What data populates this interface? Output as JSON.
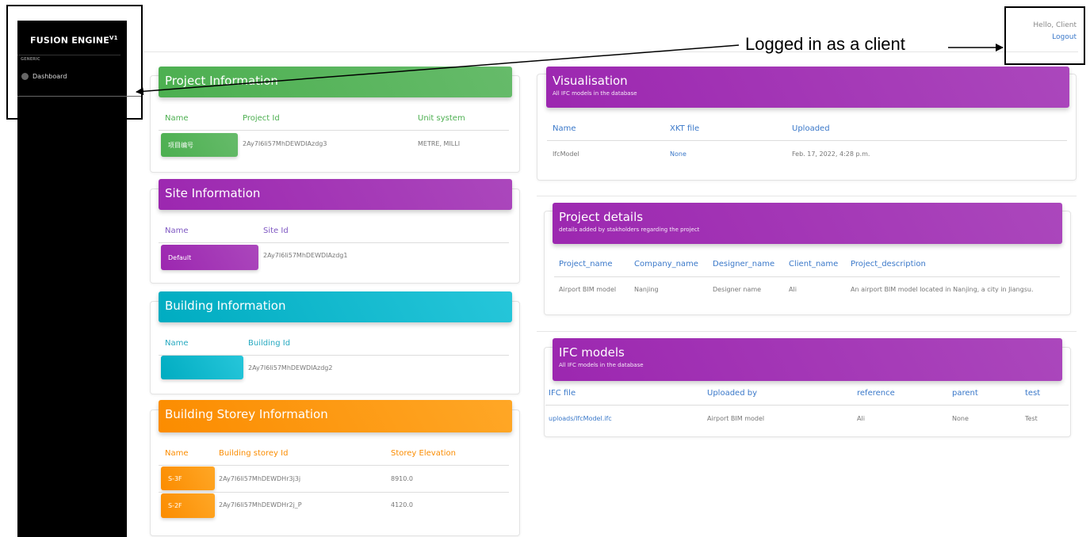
{
  "sidebar": {
    "brand": "FUSION ENGINE",
    "brand_sup": "V1",
    "section": "GENERIC",
    "items": [
      {
        "label": "Dashboard",
        "icon": "dashboard-icon"
      }
    ]
  },
  "header": {
    "greeting": "Hello, Client",
    "logout": "Logout"
  },
  "annotation": "Logged in as a client",
  "project_info": {
    "title": "Project Information",
    "columns": [
      "Name",
      "Project Id",
      "Unit system"
    ],
    "row": {
      "name": "项目编号",
      "id": "2Ay7I6li57MhDEWDIAzdg3",
      "unit": "METRE, MILLI"
    }
  },
  "site_info": {
    "title": "Site Information",
    "columns": [
      "Name",
      "Site Id"
    ],
    "row": {
      "name": "Default",
      "id": "2Ay7I6li57MhDEWDIAzdg1"
    }
  },
  "building_info": {
    "title": "Building Information",
    "columns": [
      "Name",
      "Building Id"
    ],
    "row": {
      "name": "",
      "id": "2Ay7I6li57MhDEWDIAzdg2"
    }
  },
  "storey_info": {
    "title": "Building Storey Information",
    "columns": [
      "Name",
      "Building storey Id",
      "Storey Elevation"
    ],
    "rows": [
      {
        "name": "S-3F",
        "id": "2Ay7I6li57MhDEWDHr3j3j",
        "elev": "8910.0"
      },
      {
        "name": "S-2F",
        "id": "2Ay7I6li57MhDEWDHr2j_P",
        "elev": "4120.0"
      }
    ]
  },
  "visualisation": {
    "title": "Visualisation",
    "subtitle": "All IFC models in the database",
    "columns": [
      "Name",
      "XKT file",
      "Uploaded"
    ],
    "row": {
      "name": "IfcModel",
      "xkt": "None",
      "uploaded": "Feb. 17, 2022, 4:28 p.m."
    }
  },
  "project_details": {
    "title": "Project details",
    "subtitle": "details added by stakholders regarding the project",
    "columns": [
      "Project_name",
      "Company_name",
      "Designer_name",
      "Client_name",
      "Project_description"
    ],
    "row": {
      "project": "Airport BIM model",
      "company": "Nanjing",
      "designer": "Designer name",
      "client": "Ali",
      "description": "An airport BIM model located in Nanjing, a city in Jiangsu."
    }
  },
  "ifc_models": {
    "title": "IFC models",
    "subtitle": "All IFC models in the database",
    "columns": [
      "IFC file",
      "Uploaded by",
      "reference",
      "parent",
      "test"
    ],
    "row": {
      "file": "uploads/IfcModel.ifc",
      "uploaded_by": "Airport BIM model",
      "reference": "Ali",
      "parent": "None",
      "test": "Test"
    }
  },
  "colors": {
    "green": "#4caf50",
    "purple": "#9c27b0",
    "cyan": "#00acc1",
    "orange": "#fb8c00",
    "sidebar": "#000000",
    "link": "#3a78c9"
  }
}
